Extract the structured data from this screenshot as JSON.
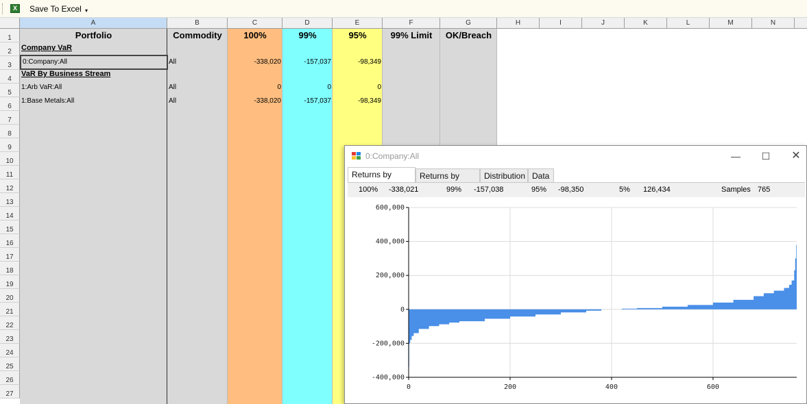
{
  "toolbar": {
    "save_label": "Save To Excel",
    "dropdown_glyph": "▾"
  },
  "columns": [
    "A",
    "B",
    "C",
    "D",
    "E",
    "F",
    "G",
    "H",
    "I",
    "J",
    "K",
    "L",
    "M",
    "N"
  ],
  "rows": [
    "1",
    "2",
    "3",
    "4",
    "5",
    "6",
    "7",
    "8",
    "9",
    "10",
    "11",
    "12",
    "13",
    "14",
    "15",
    "16",
    "17",
    "18",
    "19",
    "20",
    "21",
    "22",
    "23",
    "24",
    "25",
    "26",
    "27"
  ],
  "headers": {
    "portfolio": "Portfolio",
    "commodity": "Commodity",
    "p100": "100%",
    "p99": "99%",
    "p95": "95%",
    "limit": "99% Limit",
    "breach": "OK/Breach"
  },
  "sections": {
    "company": "Company VaR",
    "stream": "VaR By Business Stream"
  },
  "data_rows": [
    {
      "portfolio": "0:Company:All",
      "commodity": "All",
      "p100": "-338,020",
      "p99": "-157,037",
      "p95": "-98,349"
    },
    {
      "portfolio": "1:Arb VaR:All",
      "commodity": "All",
      "p100": "0",
      "p99": "0",
      "p95": "0"
    },
    {
      "portfolio": "1:Base Metals:All",
      "commodity": "All",
      "p100": "-338,020",
      "p99": "-157,037",
      "p95": "-98,349"
    }
  ],
  "colors": {
    "c100": "#ffbe80",
    "c99": "#80ffff",
    "c95": "#ffff80",
    "grey": "#d9d9d9",
    "bar": "#4a8fe8"
  },
  "popup": {
    "title": "0:Company:All",
    "tabs": [
      "Returns by Value",
      "Returns by Time",
      "Distribution",
      "Data"
    ],
    "active_tab": "Returns by Value",
    "stats": {
      "l100": "100%",
      "v100": "-338,021",
      "l99": "99%",
      "v99": "-157,038",
      "l95": "95%",
      "v95": "-98,350",
      "l5": "5%",
      "v5": "126,434",
      "lsamples": "Samples",
      "vsamples": "765"
    }
  },
  "chart_data": {
    "type": "area",
    "title": "",
    "xlabel": "",
    "ylabel": "",
    "xlim": [
      0,
      765
    ],
    "ylim": [
      -400000,
      600000
    ],
    "xticks": [
      0,
      200,
      400,
      600
    ],
    "xtick_labels": [
      "0",
      "200",
      "400",
      "600"
    ],
    "yticks": [
      -400000,
      -200000,
      0,
      200000,
      400000,
      600000
    ],
    "ytick_labels": [
      "-400,000",
      "-200,000",
      "0",
      "200,000",
      "400,000",
      "600,000"
    ],
    "grid": true,
    "series": [
      {
        "x": [
          0,
          1,
          3,
          6,
          10,
          20,
          40,
          60,
          80,
          100,
          150,
          200,
          250,
          300,
          350,
          380,
          420,
          450,
          500,
          550,
          600,
          640,
          680,
          700,
          720,
          740,
          750,
          755,
          760,
          762,
          764,
          765
        ],
        "y": [
          -338021,
          -200000,
          -180000,
          -157038,
          -140000,
          -115000,
          -98350,
          -88000,
          -78000,
          -70000,
          -55000,
          -42000,
          -30000,
          -18000,
          -8000,
          0,
          4000,
          8000,
          16000,
          26000,
          40000,
          56000,
          78000,
          95000,
          110000,
          126434,
          145000,
          170000,
          230000,
          300000,
          380000,
          420000
        ]
      }
    ]
  }
}
